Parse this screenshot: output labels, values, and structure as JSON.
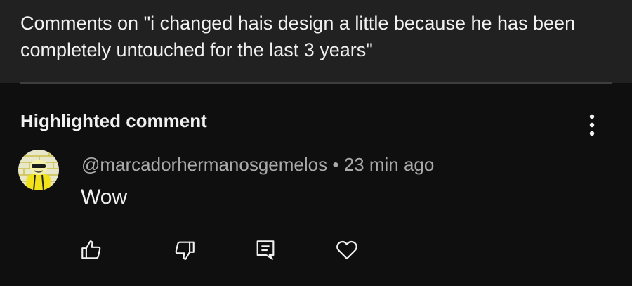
{
  "header": {
    "title": "Comments on \"i changed hais design a little because he has been completely untouched for the last 3 years\""
  },
  "section": {
    "label": "Highlighted comment"
  },
  "comment": {
    "author": "@marcadorhermanosgemelos",
    "separator": "•",
    "time": "23 min ago",
    "text": "Wow"
  },
  "actions": {
    "icons": [
      "thumbs-up-icon",
      "thumbs-down-icon",
      "reply-icon",
      "heart-icon"
    ]
  },
  "colors": {
    "background": "#0f0f0f",
    "header_background": "#212121",
    "primary_text": "#f1f1f1",
    "secondary_text": "#aaaaaa",
    "avatar_yellow": "#f2e21c"
  }
}
